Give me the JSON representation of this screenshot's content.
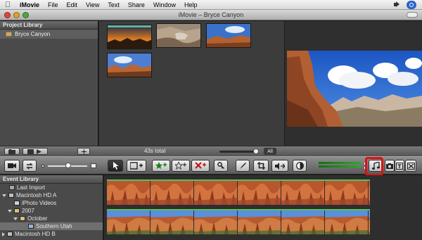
{
  "menubar": {
    "app_name": "iMovie",
    "items": [
      "File",
      "Edit",
      "View",
      "Text",
      "Share",
      "Window",
      "Help"
    ]
  },
  "window": {
    "title": "iMovie – Bryce Canyon"
  },
  "project_library": {
    "header": "Project Library",
    "projects": [
      {
        "label": "Bryce Canyon",
        "selected": true
      }
    ]
  },
  "project_browser": {
    "clip_count": 4,
    "total": "43s total",
    "zoom_all_label": "All"
  },
  "toolbar": {
    "buttons": [
      "camera-import",
      "swap-view",
      "arrow-tool",
      "add-to-project",
      "mark-favorite",
      "unmark",
      "reject",
      "keyword",
      "color-picker",
      "crop",
      "voiceover",
      "adjust",
      "music-and-sound-effects",
      "photos",
      "titles",
      "transitions"
    ],
    "highlighted_button": "music-and-sound-effects",
    "colors": {
      "highlight": "#e01010",
      "meter": "#2ca82c"
    }
  },
  "event_library": {
    "header": "Event Library",
    "items": [
      {
        "label": "Last Import",
        "indent": 1,
        "icon": "film-icon"
      },
      {
        "label": "Macintosh HD A",
        "indent": 0,
        "icon": "hard-drive-icon",
        "expanded": true
      },
      {
        "label": "iPhoto Videos",
        "indent": 2,
        "icon": "star-icon"
      },
      {
        "label": "2007",
        "indent": 1,
        "icon": "folder-icon",
        "expanded": true
      },
      {
        "label": "October",
        "indent": 2,
        "icon": "folder-icon",
        "expanded": true
      },
      {
        "label": "Southern Utah",
        "indent": 3,
        "icon": "event-icon",
        "selected": true
      },
      {
        "label": "Macintosh HD B",
        "indent": 0,
        "icon": "hard-drive-icon",
        "expanded": false
      }
    ]
  }
}
